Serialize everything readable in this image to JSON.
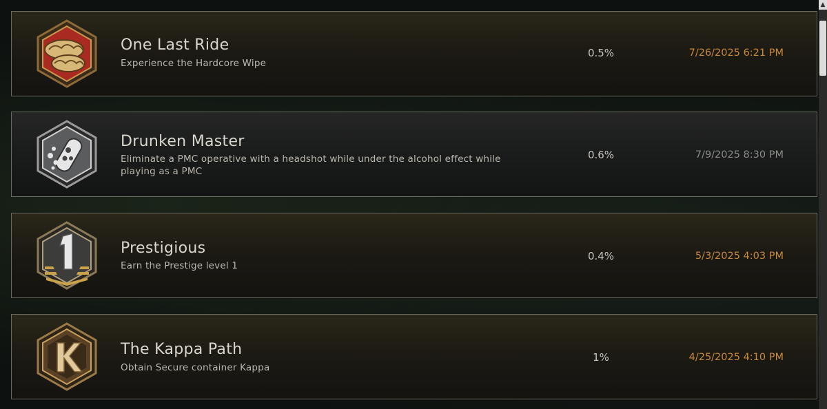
{
  "achievements": [
    {
      "title": "One Last Ride",
      "description": "Experience the Hardcore Wipe",
      "percent": "0.5%",
      "date": "7/26/2025 6:21 PM",
      "tier": "gold",
      "icon": "red-brain-icon"
    },
    {
      "title": "Drunken Master",
      "description": "Eliminate a PMC operative with a headshot while under the alcohol effect while playing as a PMC",
      "percent": "0.6%",
      "date": "7/9/2025 8:30 PM",
      "tier": "grey",
      "icon": "bubbles-bottle-icon"
    },
    {
      "title": "Prestigious",
      "description": "Earn the Prestige level 1",
      "percent": "0.4%",
      "date": "5/3/2025 4:03 PM",
      "tier": "gold",
      "icon": "prestige-one-chevron-icon"
    },
    {
      "title": "The Kappa Path",
      "description": "Obtain Secure container Kappa",
      "percent": "1%",
      "date": "4/25/2025 4:10 PM",
      "tier": "gold",
      "icon": "kappa-letter-icon"
    }
  ],
  "colors": {
    "gold_date": "#c9893b",
    "grey_date": "#8a8a86"
  }
}
